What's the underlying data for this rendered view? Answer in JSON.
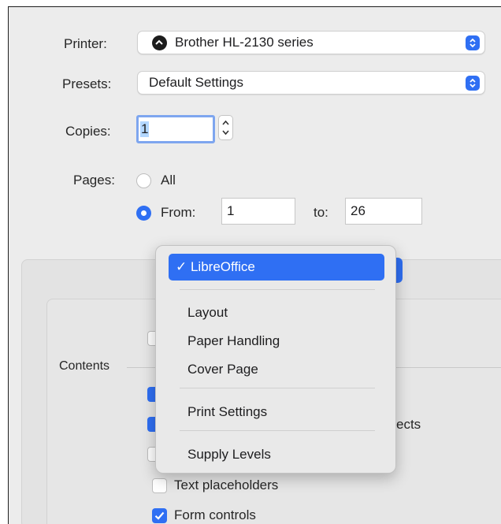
{
  "printer": {
    "label": "Printer:",
    "value": "Brother HL-2130 series"
  },
  "presets": {
    "label": "Presets:",
    "value": "Default Settings"
  },
  "copies": {
    "label": "Copies:",
    "value": "1"
  },
  "pages": {
    "label": "Pages:",
    "all_label": "All",
    "from_label": "From:",
    "from_value": "1",
    "to_label": "to:",
    "to_value": "26",
    "selected": "from"
  },
  "menu": {
    "selected": "✓ LibreOffice",
    "items": [
      "Layout",
      "Paper Handling",
      "Cover Page"
    ],
    "print_settings": "Print Settings",
    "supply_levels": "Supply Levels"
  },
  "contents": {
    "label": "Contents",
    "partially_hidden_text": "ects",
    "options": [
      {
        "label": "Text placeholders",
        "checked": false
      },
      {
        "label": "Form controls",
        "checked": true
      }
    ]
  },
  "colors": {
    "accent": "#2f6ff3",
    "window_bg": "#ececec"
  }
}
